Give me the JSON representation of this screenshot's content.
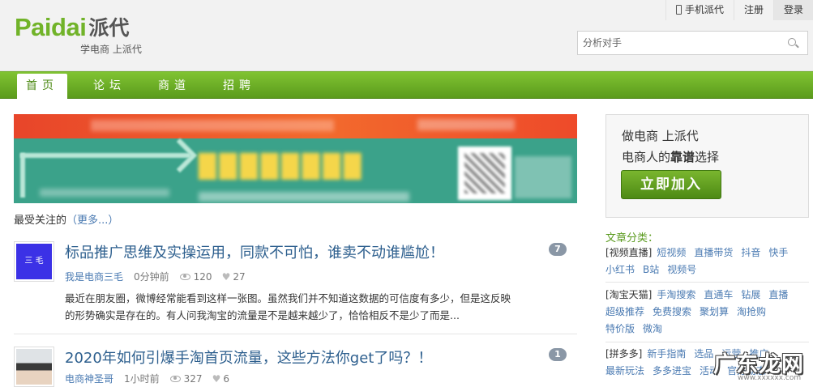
{
  "header": {
    "logo_en": "Paidai",
    "logo_cn": "派代",
    "slogan": "学电商 上派代",
    "links": {
      "mobile": "手机派代",
      "register": "注册",
      "login": "登录"
    },
    "search_placeholder": "分析对手"
  },
  "nav": {
    "items": [
      "首页",
      "论坛",
      "商道",
      "招聘"
    ],
    "active": "首页"
  },
  "most_followed": {
    "label": "最受关注的",
    "more": "（更多...）"
  },
  "articles": [
    {
      "title": "标品推广思维及实操运用，同款不可怕，谁卖不动谁尴尬！",
      "author": "我是电商三毛",
      "time": "0分钟前",
      "views": "120",
      "likes": "27",
      "comments": "7",
      "avatar_text": "三  毛",
      "avatar_color": "#3b31e6",
      "excerpt": "最近在朋友圈，微博经常能看到这样一张图。虽然我们并不知道这数据的可信度有多少，但是这反映的形势确实是存在的。有人问我淘宝的流量是不是越来越少了，恰恰相反不是少了而是..."
    },
    {
      "title": "2020年如何引爆手淘首页流量，这些方法你get了吗？！",
      "author": "电商神圣哥",
      "time": "1小时前",
      "views": "327",
      "likes": "6",
      "comments": "1"
    }
  ],
  "sidebar": {
    "join_line1": "做电商 上派代",
    "join_line2_pre": "电商人的",
    "join_line2_bold": "靠谱",
    "join_line2_post": "选择",
    "join_button": "立即加入",
    "category_title": "文章分类：",
    "categories": [
      {
        "name": "[视频直播]",
        "links": [
          "短视频",
          "直播带货",
          "抖音",
          "快手",
          "小红书",
          "B站",
          "视频号"
        ]
      },
      {
        "name": "[淘宝天猫]",
        "links": [
          "手淘搜索",
          "直通车",
          "钻展",
          "直播",
          "超级推荐",
          "免费搜索",
          "聚划算",
          "淘抢购",
          "特价版",
          "微淘"
        ]
      },
      {
        "name": "[拼多多]",
        "links": [
          "新手指南",
          "选品",
          "运营",
          "推广",
          "最新玩法",
          "多多进宝",
          "活动",
          "官方动态"
        ]
      }
    ]
  },
  "watermark": {
    "text": "广东龙网",
    "url": "www.xxxxxx.com"
  },
  "colors": {
    "brand_green": "#71b329",
    "nav_green": "#5b9b1c",
    "link_blue": "#4a7ab2",
    "title_blue": "#2d5f8e"
  }
}
